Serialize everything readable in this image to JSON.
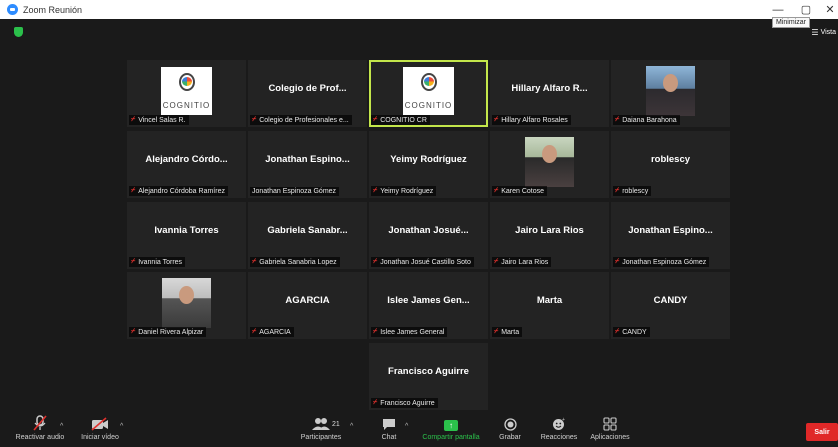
{
  "window": {
    "title": "Zoom Reunión",
    "minimize_glyph": "—",
    "maximize_glyph": "▢",
    "close_glyph": "✕",
    "tooltip": "Minimizar"
  },
  "top_bar": {
    "view_label": "Vista",
    "view_glyph": "☰"
  },
  "colors": {
    "accent_green": "#2bc04b",
    "active_border": "#c3e64b",
    "leave_red": "#e02828",
    "tile_bg": "#232323"
  },
  "tiles": [
    {
      "name": "",
      "label": "Vincel Salas R.",
      "media": "logo",
      "logo_text": "COGNITIO"
    },
    {
      "name": "Colegio de Prof...",
      "label": "Colegio de Profesionales e..."
    },
    {
      "name": "",
      "label": "COGNITIO CR",
      "media": "logo",
      "logo_text": "COGNITIO",
      "active": true
    },
    {
      "name": "Hillary Alfaro R...",
      "label": "Hillary Alfaro Rosales"
    },
    {
      "name": "",
      "label": "Daiana Barahona",
      "media": "photo"
    },
    {
      "name": "Alejandro Córdo...",
      "label": "Alejandro Córdoba Ramírez"
    },
    {
      "name": "Jonathan Espino...",
      "label": "Jonathan Espinoza Gómez",
      "no_mic": true
    },
    {
      "name": "Yeimy Rodríguez",
      "label": "Yeimy Rodríguez"
    },
    {
      "name": "",
      "label": "Karen Cotose",
      "media": "photo"
    },
    {
      "name": "roblescy",
      "label": "roblescy"
    },
    {
      "name": "Ivannia Torres",
      "label": "Ivannia Torres"
    },
    {
      "name": "Gabriela Sanabr...",
      "label": "Gabriela Sanabria Lopez"
    },
    {
      "name": "Jonathan Josué...",
      "label": "Jonathan Josué Castillo Soto"
    },
    {
      "name": "Jairo Lara Rios",
      "label": "Jairo Lara Rios"
    },
    {
      "name": "Jonathan Espino...",
      "label": "Jonathan Espinoza Gómez"
    },
    {
      "name": "",
      "label": "Daniel Rivera Alpizar",
      "media": "photo"
    },
    {
      "name": "AGARCIA",
      "label": "AGARCIA"
    },
    {
      "name": "Islee James Gen...",
      "label": "Islee James General"
    },
    {
      "name": "Marta",
      "label": "Marta"
    },
    {
      "name": "CANDY",
      "label": "CANDY"
    },
    {
      "name": "Francisco Aguirre",
      "label": "Francisco Aguirre"
    }
  ],
  "toolbar": {
    "unmute": {
      "label": "Reactivar audio",
      "icon": "mic-muted-icon"
    },
    "start_video": {
      "label": "Iniciar vídeo",
      "icon": "video-off-icon"
    },
    "participants": {
      "label": "Participantes",
      "count": "21",
      "icon": "participants-icon"
    },
    "chat": {
      "label": "Chat",
      "icon": "chat-icon"
    },
    "share": {
      "label": "Compartir pantalla",
      "icon": "share-screen-icon"
    },
    "record": {
      "label": "Grabar",
      "icon": "record-icon"
    },
    "reactions": {
      "label": "Reacciones",
      "icon": "reactions-icon"
    },
    "apps": {
      "label": "Aplicaciones",
      "icon": "apps-icon"
    },
    "leave": {
      "label": "Salir"
    }
  }
}
